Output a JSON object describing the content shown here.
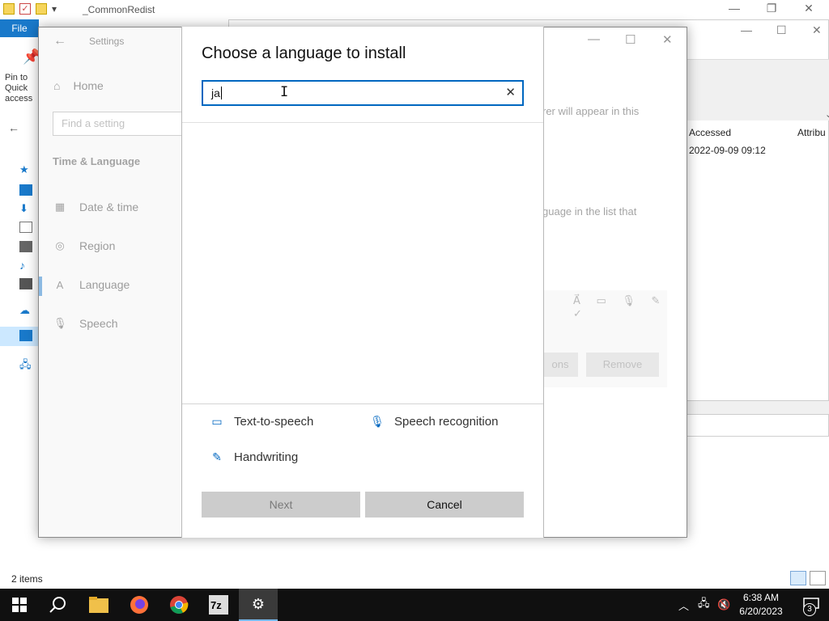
{
  "explorer": {
    "title": "_CommonRedist",
    "file_tab": "File",
    "pin_label": "Pin to Quick access",
    "status": "2 items",
    "columns": {
      "accessed": "Accessed",
      "attributes": "Attribu"
    },
    "row": {
      "accessed": "2022-09-09 09:12"
    }
  },
  "settings": {
    "window_title": "Settings",
    "home": "Home",
    "search_placeholder": "Find a setting",
    "section": "Time & Language",
    "nav": [
      {
        "label": "Date & time",
        "icon": "calendar-icon"
      },
      {
        "label": "Region",
        "icon": "globe-icon"
      },
      {
        "label": "Language",
        "icon": "language-icon"
      },
      {
        "label": "Speech",
        "icon": "microphone-icon"
      }
    ],
    "right_text_1": "rer will appear in this",
    "right_text_2": "guage in the list that",
    "options_btn": "ons",
    "remove_btn": "Remove"
  },
  "dialog": {
    "title": "Choose a language to install",
    "search_value": "ja",
    "features": {
      "tts": "Text-to-speech",
      "speech": "Speech recognition",
      "handwriting": "Handwriting"
    },
    "next_btn": "Next",
    "cancel_btn": "Cancel"
  },
  "taskbar": {
    "time": "6:38 AM",
    "date": "6/20/2023",
    "notif_count": "3",
    "apps": [
      "start-icon",
      "search-icon",
      "file-explorer-icon",
      "firefox-icon",
      "chrome-icon",
      "7zip-icon",
      "settings-icon"
    ]
  },
  "colors": {
    "accent": "#0067c0",
    "taskbar": "#101010",
    "button_gray": "#cccccc"
  }
}
